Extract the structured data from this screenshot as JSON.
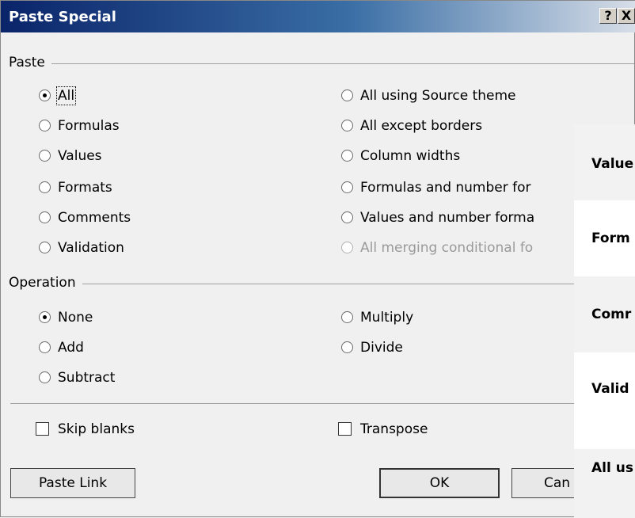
{
  "title": "Paste Special",
  "title_buttons": {
    "help": "?",
    "close": "X"
  },
  "groups": {
    "paste": "Paste",
    "operation": "Operation"
  },
  "paste_left": [
    "All",
    "Formulas",
    "Values",
    "Formats",
    "Comments",
    "Validation"
  ],
  "paste_right": [
    "All using Source theme",
    "All except borders",
    "Column widths",
    "Formulas and number for",
    "Values and number forma",
    "All merging conditional fo"
  ],
  "operation_left": [
    "None",
    "Add",
    "Subtract"
  ],
  "operation_right": [
    "Multiply",
    "Divide"
  ],
  "checkboxes": {
    "skip_blanks": "Skip blanks",
    "transpose": "Transpose"
  },
  "buttons": {
    "paste_link": "Paste Link",
    "ok": "OK",
    "cancel": "Can"
  },
  "overlay": [
    "Value",
    "Form",
    "Comr",
    "Valid",
    "All us"
  ]
}
